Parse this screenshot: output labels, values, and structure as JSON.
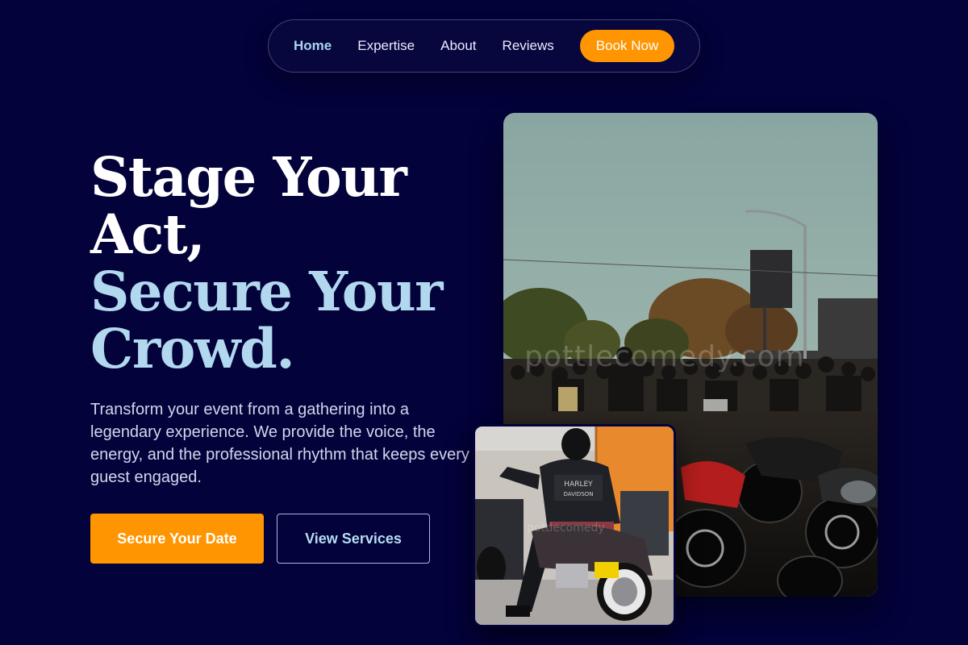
{
  "nav": {
    "links": [
      {
        "label": "Home",
        "active": true
      },
      {
        "label": "Expertise",
        "active": false
      },
      {
        "label": "About",
        "active": false
      },
      {
        "label": "Reviews",
        "active": false
      }
    ],
    "cta_label": "Book Now"
  },
  "hero": {
    "title_lines": [
      "Stage Your",
      "Act,"
    ],
    "highlight_lines": [
      "Secure Your",
      "Crowd."
    ],
    "description": "Transform your event from a gathering into a legendary experience. We provide the voice, the energy, and the professional rhythm that keeps every guest engaged.",
    "primary_button": "Secure Your Date",
    "secondary_button": "View Services"
  },
  "images": {
    "large_watermark": "pottlecomedy.com",
    "small_watermark": "pottlecomedy"
  },
  "colors": {
    "background": "#03023a",
    "accent": "#ff9500",
    "highlight": "#b2d8ef"
  }
}
